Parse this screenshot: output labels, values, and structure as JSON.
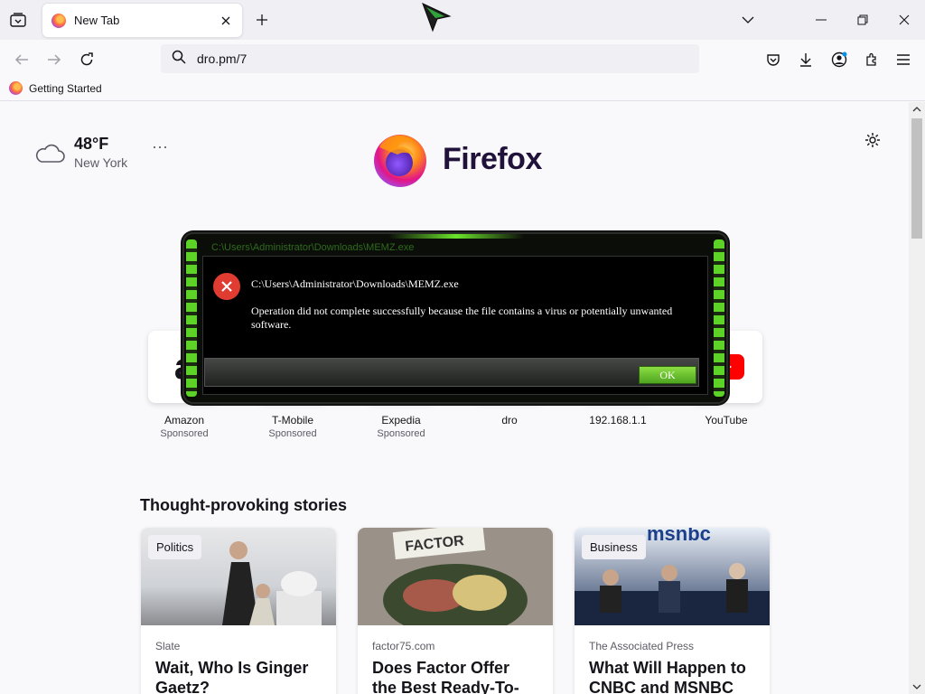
{
  "browser": {
    "tab_title": "New Tab",
    "url": "dro.pm/7",
    "bookmark": "Getting Started"
  },
  "weather": {
    "temp": "48°F",
    "city": "New York"
  },
  "logo": {
    "word": "Firefox"
  },
  "tiles": [
    {
      "name": "Amazon",
      "sponsored": "Sponsored"
    },
    {
      "name": "T-Mobile",
      "sponsored": "Sponsored"
    },
    {
      "name": "Expedia",
      "sponsored": "Sponsored"
    },
    {
      "name": "dro",
      "sponsored": ""
    },
    {
      "name": "192.168.1.1",
      "sponsored": ""
    },
    {
      "name": "YouTube",
      "sponsored": ""
    }
  ],
  "stories": {
    "heading": "Thought-provoking stories",
    "cards": [
      {
        "tag": "Politics",
        "source": "Slate",
        "headline": "Wait, Who Is Ginger Gaetz?"
      },
      {
        "tag": "",
        "source": "factor75.com",
        "headline": "Does Factor Offer the Best Ready-To-Eat"
      },
      {
        "tag": "Business",
        "source": "The Associated Press",
        "headline": "What Will Happen to CNBC and MSNBC"
      }
    ]
  },
  "dialog": {
    "caption": "C:\\Users\\Administrator\\Downloads\\MEMZ.exe",
    "path": "C:\\Users\\Administrator\\Downloads\\MEMZ.exe",
    "message": "Operation did not complete successfully because the file contains a virus or potentially unwanted software.",
    "ok": "OK"
  },
  "colors": {
    "accent_green": "#5ed327",
    "error_red": "#e03c31"
  }
}
